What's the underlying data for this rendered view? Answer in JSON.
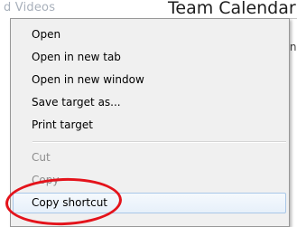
{
  "background": {
    "link_fragment": "d Videos",
    "title": "Team Calendar",
    "text_fragment_1": "y n",
    "text_fragment_2": "t"
  },
  "context_menu": {
    "items": [
      {
        "label": "Open",
        "enabled": true
      },
      {
        "label": "Open in new tab",
        "enabled": true
      },
      {
        "label": "Open in new window",
        "enabled": true
      },
      {
        "label": "Save target as...",
        "enabled": true
      },
      {
        "label": "Print target",
        "enabled": true
      },
      {
        "label": "Cut",
        "enabled": false
      },
      {
        "label": "Copy",
        "enabled": false
      },
      {
        "label": "Copy shortcut",
        "enabled": true,
        "hovered": true
      }
    ]
  },
  "colors": {
    "menu_background": "#f0f0f0",
    "hover_border": "#a9c7e8",
    "annotation_red": "#e4131b",
    "disabled_text": "#8d8d8d"
  }
}
